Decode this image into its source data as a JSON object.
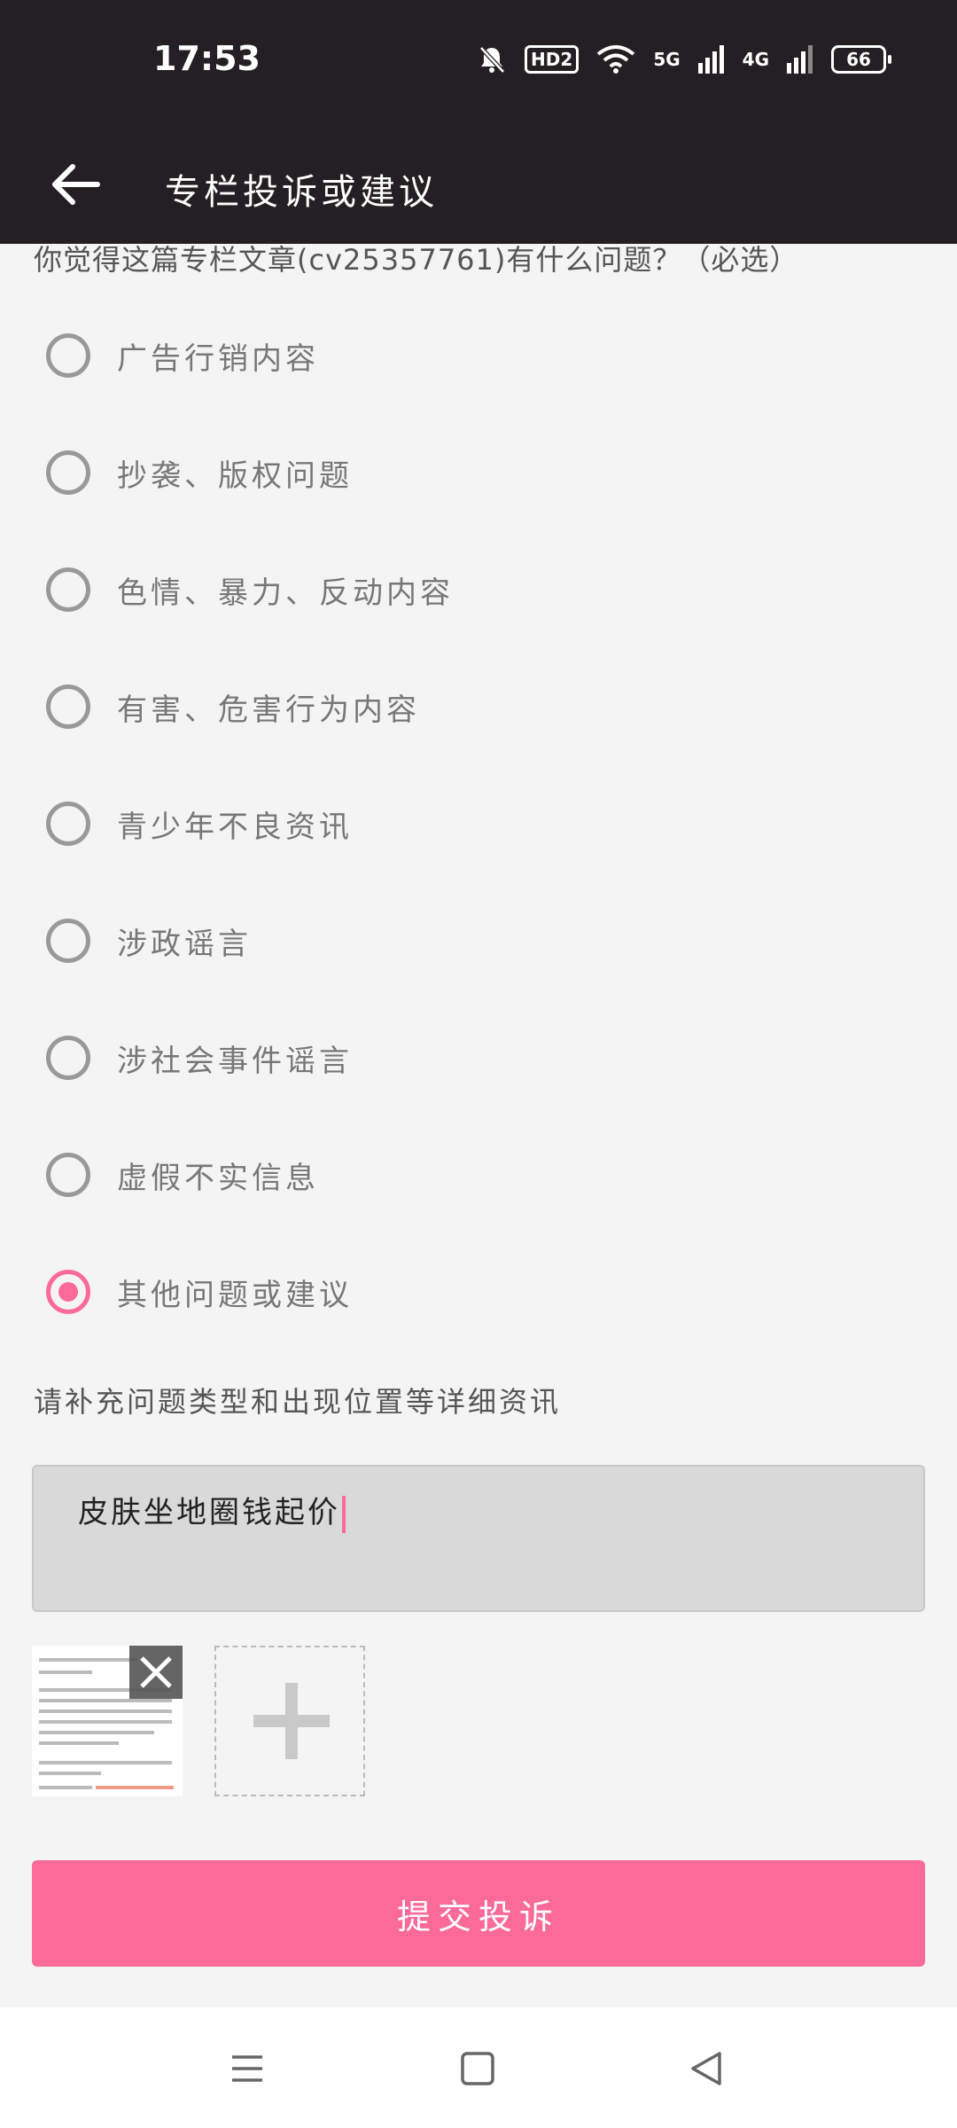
{
  "status_bar": {
    "time": "17:53",
    "hd": "HD2",
    "net1": "5G",
    "net2": "4G",
    "battery": "66"
  },
  "toolbar": {
    "title": "专栏投诉或建议"
  },
  "form": {
    "question": "你觉得这篇专栏文章(cv25357761)有什么问题？（必选）",
    "options": [
      {
        "label": "广告行销内容",
        "checked": false
      },
      {
        "label": "抄袭、版权问题",
        "checked": false
      },
      {
        "label": "色情、暴力、反动内容",
        "checked": false
      },
      {
        "label": "有害、危害行为内容",
        "checked": false
      },
      {
        "label": "青少年不良资讯",
        "checked": false
      },
      {
        "label": "涉政谣言",
        "checked": false
      },
      {
        "label": "涉社会事件谣言",
        "checked": false
      },
      {
        "label": "虚假不实信息",
        "checked": false
      },
      {
        "label": "其他问题或建议",
        "checked": true
      }
    ],
    "detail_label": "请补充问题类型和出现位置等详细资讯",
    "detail_value": "皮肤坐地圈钱起价",
    "submit_label": "提交投诉"
  },
  "colors": {
    "accent": "#fb6a98",
    "header": "#231f22",
    "background": "#f4f4f4"
  },
  "icons": {
    "back": "arrow-left-icon",
    "close": "close-icon",
    "add": "plus-icon",
    "nav_menu": "menu-icon",
    "nav_home": "square-icon",
    "nav_back": "triangle-back-icon"
  }
}
